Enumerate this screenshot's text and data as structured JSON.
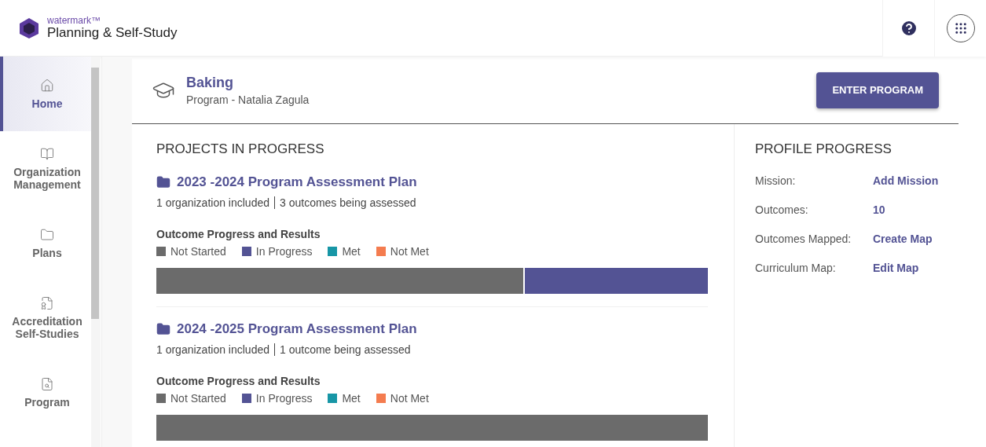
{
  "header": {
    "brand": "watermark™",
    "title": "Planning & Self-Study"
  },
  "sidebar": {
    "items": [
      {
        "label": "Home",
        "selected": true
      },
      {
        "label": "Organization Management",
        "selected": false
      },
      {
        "label": "Plans",
        "selected": false
      },
      {
        "label": "Accreditation Self-Studies",
        "selected": false
      },
      {
        "label": "Program",
        "selected": false
      }
    ]
  },
  "program": {
    "name": "Baking",
    "subtitle": "Program - Natalia Zagula",
    "button": "ENTER PROGRAM"
  },
  "projects": {
    "heading": "PROJECTS IN PROGRESS",
    "items": [
      {
        "title": "2023 -2024 Program Assessment Plan",
        "left": "1 organization included",
        "right": "3 outcomes being assessed",
        "chart_heading": "Outcome Progress and Results",
        "legend": [
          {
            "label": "Not Started",
            "color": "#6b6b6b"
          },
          {
            "label": "In Progress",
            "color": "#535394"
          },
          {
            "label": "Met",
            "color": "#1796a6"
          },
          {
            "label": "Not Met",
            "color": "#f47c4f"
          }
        ],
        "segments": [
          {
            "color": "#6b6b6b",
            "level": 0.667
          },
          {
            "color": "#535394",
            "level": 0.333
          }
        ]
      },
      {
        "title": "2024 -2025 Program Assessment Plan",
        "left": "1 organization included",
        "right": "1 outcome being assessed",
        "chart_heading": "Outcome Progress and Results",
        "legend": [
          {
            "label": "Not Started",
            "color": "#6b6b6b"
          },
          {
            "label": "In Progress",
            "color": "#535394"
          },
          {
            "label": "Met",
            "color": "#1796a6"
          },
          {
            "label": "Not Met",
            "color": "#f47c4f"
          }
        ],
        "segments": [
          {
            "color": "#6b6b6b",
            "level": 1
          }
        ]
      }
    ]
  },
  "profile": {
    "heading": "PROFILE PROGRESS",
    "rows": [
      {
        "label": "Mission:",
        "value": "Add Mission"
      },
      {
        "label": "Outcomes:",
        "value": "10"
      },
      {
        "label": "Outcomes Mapped:",
        "value": "Create Map"
      },
      {
        "label": "Curriculum Map:",
        "value": "Edit Map"
      }
    ]
  }
}
